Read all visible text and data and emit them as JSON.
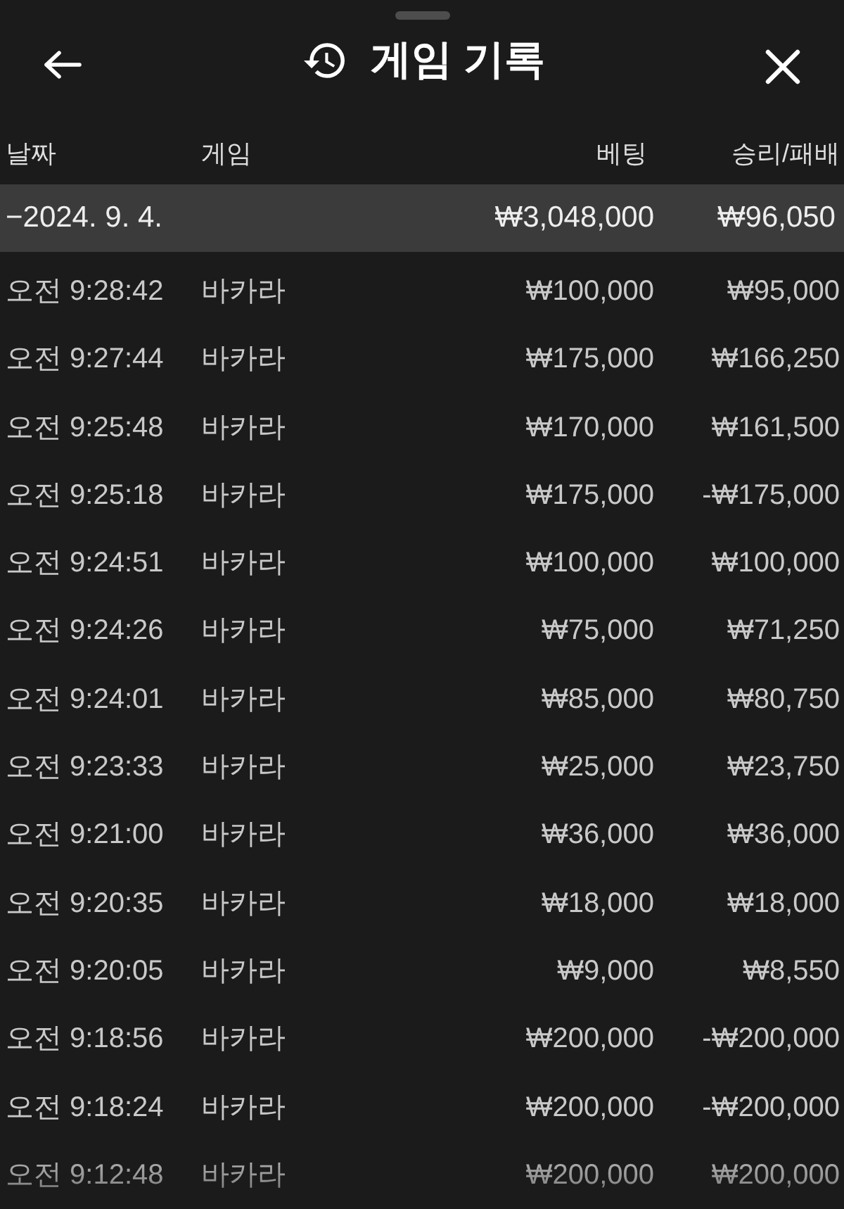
{
  "window": {
    "title": "게임 기록"
  },
  "table": {
    "columns": [
      "날짜",
      "게임",
      "베팅",
      "승리/패배"
    ],
    "groups": [
      {
        "date": "−2024. 9. 4.",
        "bet_total": "₩3,048,000",
        "result_total": "₩96,050",
        "rows": [
          {
            "time": "오전 9:28:42",
            "game": "바카라",
            "bet": "₩100,000",
            "result": "₩95,000"
          },
          {
            "time": "오전 9:27:44",
            "game": "바카라",
            "bet": "₩175,000",
            "result": "₩166,250"
          },
          {
            "time": "오전 9:25:48",
            "game": "바카라",
            "bet": "₩170,000",
            "result": "₩161,500"
          },
          {
            "time": "오전 9:25:18",
            "game": "바카라",
            "bet": "₩175,000",
            "result": "-₩175,000"
          },
          {
            "time": "오전 9:24:51",
            "game": "바카라",
            "bet": "₩100,000",
            "result": "₩100,000"
          },
          {
            "time": "오전 9:24:26",
            "game": "바카라",
            "bet": "₩75,000",
            "result": "₩71,250"
          },
          {
            "time": "오전 9:24:01",
            "game": "바카라",
            "bet": "₩85,000",
            "result": "₩80,750"
          },
          {
            "time": "오전 9:23:33",
            "game": "바카라",
            "bet": "₩25,000",
            "result": "₩23,750"
          },
          {
            "time": "오전 9:21:00",
            "game": "바카라",
            "bet": "₩36,000",
            "result": "₩36,000"
          },
          {
            "time": "오전 9:20:35",
            "game": "바카라",
            "bet": "₩18,000",
            "result": "₩18,000"
          },
          {
            "time": "오전 9:20:05",
            "game": "바카라",
            "bet": "₩9,000",
            "result": "₩8,550"
          },
          {
            "time": "오전 9:18:56",
            "game": "바카라",
            "bet": "₩200,000",
            "result": "-₩200,000"
          },
          {
            "time": "오전 9:18:24",
            "game": "바카라",
            "bet": "₩200,000",
            "result": "-₩200,000"
          },
          {
            "time": "오전 9:12:48",
            "game": "바카라",
            "bet": "₩200,000",
            "result": "₩200,000"
          }
        ]
      }
    ]
  }
}
